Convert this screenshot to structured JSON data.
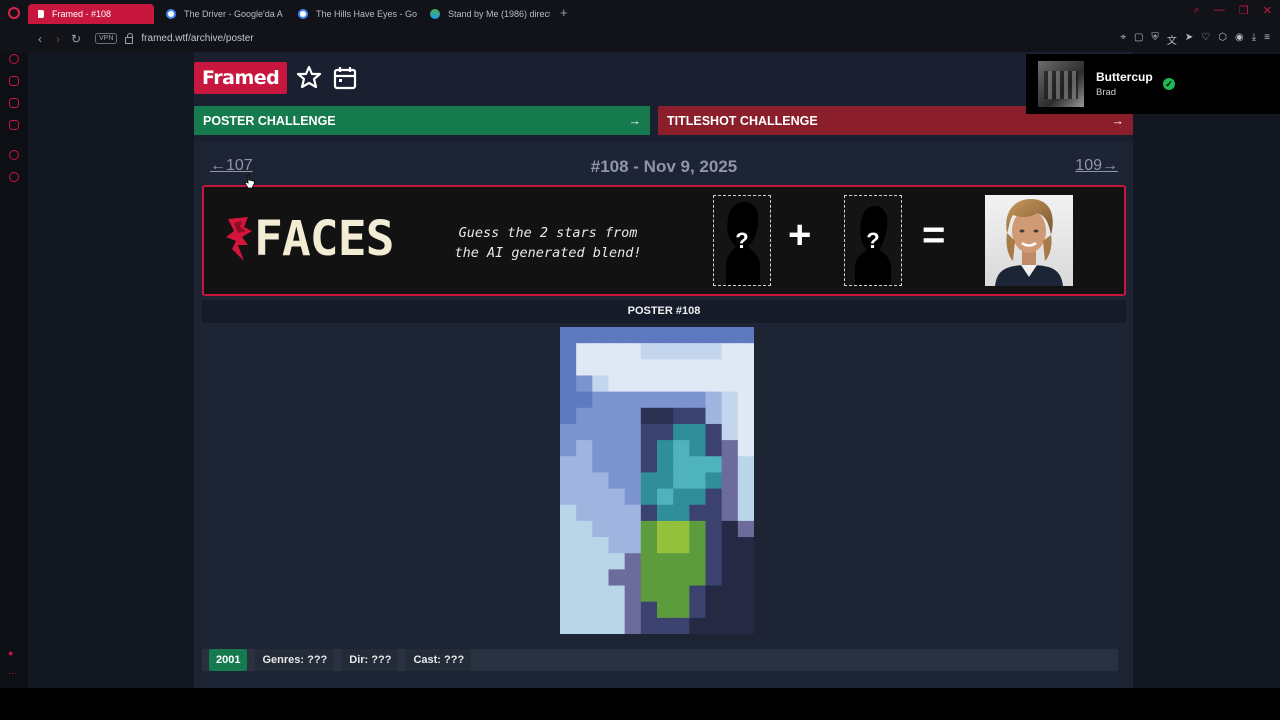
{
  "browser": {
    "tabs": [
      {
        "label": "Framed - #108",
        "active": true,
        "icon": "framed-favicon"
      },
      {
        "label": "The Driver - Google'da A",
        "active": false,
        "icon": "google-favicon"
      },
      {
        "label": "The Hills Have Eyes - Go",
        "active": false,
        "icon": "google-favicon"
      },
      {
        "label": "Stand by Me (1986) direct",
        "active": false,
        "icon": "wiki-favicon"
      }
    ],
    "new_tab": "+",
    "vpn": "VPN",
    "url": "framed.wtf/archive/poster"
  },
  "header": {
    "logo": "Framed"
  },
  "challenges": {
    "poster": {
      "label": "POSTER CHALLENGE",
      "arrow": "→"
    },
    "titleshot": {
      "label": "TITLESHOT CHALLENGE",
      "arrow": "→"
    }
  },
  "nav": {
    "prev": "←107",
    "title": "#108 - Nov 9, 2025",
    "next": "109→"
  },
  "faces": {
    "logo_text": "FACES",
    "tagline_1": "Guess the 2 stars from",
    "tagline_2": "the AI generated blend!",
    "slot_1": "?",
    "slot_2": "?",
    "plus": "+",
    "equals": "="
  },
  "poster": {
    "header": "POSTER #108"
  },
  "meta": {
    "year": "2001",
    "genres": "Genres: ???",
    "director": "Dir: ???",
    "cast": "Cast: ???"
  },
  "now_playing": {
    "title": "Buttercup",
    "artist": "Brad"
  },
  "colors": {
    "brand_red": "#c8173f",
    "poster_green": "#167a4f",
    "titleshot_red": "#8a1e2a",
    "check_green": "#1db954"
  }
}
